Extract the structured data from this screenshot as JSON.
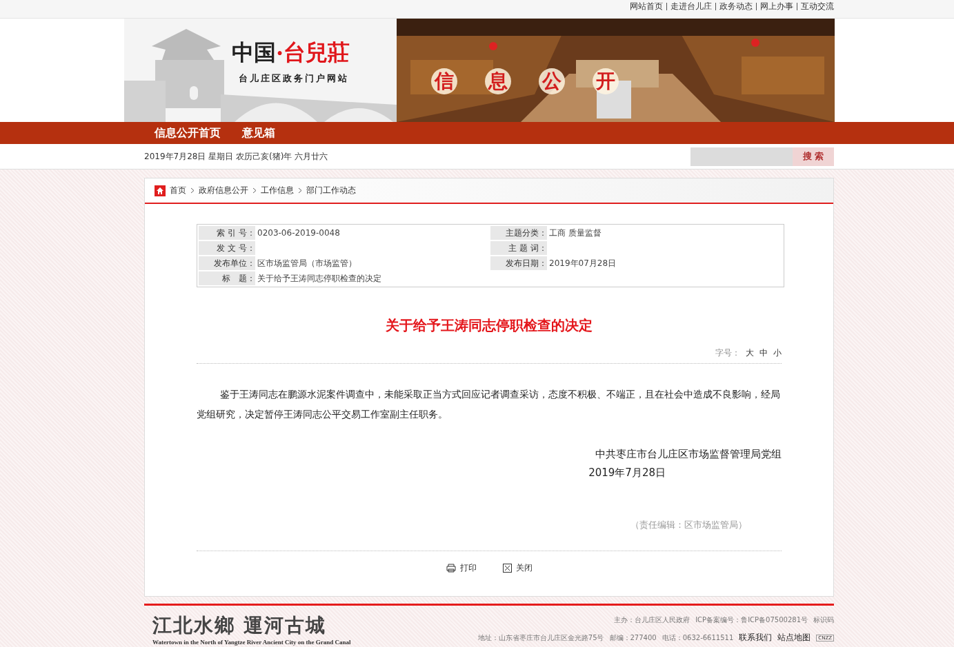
{
  "top_links": [
    "网站首页",
    "走进台儿庄",
    "政务动态",
    "网上办事",
    "互动交流"
  ],
  "header": {
    "logo_main": "中国",
    "logo_dot": "·",
    "logo_accent": "台兒莊",
    "logo_sub": "台儿庄区政务门户网站",
    "banner_title": [
      "信",
      "息",
      "公",
      "开"
    ],
    "photo": {
      "kind": "picture"
    }
  },
  "nav": [
    "信息公开首页",
    "意见箱"
  ],
  "date_line": "2019年7月28日  星期日  农历己亥(猪)年  六月廿六",
  "search": {
    "button": "搜 索"
  },
  "breadcrumb": [
    "首页",
    "政府信息公开",
    "工作信息",
    "部门工作动态"
  ],
  "info_table": [
    [
      {
        "label": "索 引 号：",
        "value": "0203-06-2019-0048"
      },
      {
        "label": "主题分类：",
        "value": "工商 质量监督"
      }
    ],
    [
      {
        "label": "发 文 号："
      },
      {
        "label": "主 题 词："
      }
    ],
    [
      {
        "label": "发布单位：",
        "value": "区市场监管局（市场监管）"
      },
      {
        "label": "发布日期：",
        "value": "2019年07月28日"
      }
    ],
    [
      {
        "label": "标　题：",
        "value": "关于给予王涛同志停职检查的决定"
      }
    ]
  ],
  "article": {
    "title": "关于给予王涛同志停职检查的决定",
    "font_label": "字号：",
    "font_sizes": [
      "大",
      "中",
      "小"
    ],
    "paragraph": "鉴于王涛同志在鹏源水泥案件调查中，未能采取正当方式回应记者调查采访，态度不积极、不端正，且在社会中造成不良影响，经局党组研究，决定暂停王涛同志公平交易工作室副主任职务。",
    "signature": "中共枣庄市台儿庄区市场监督管理局党组",
    "sign_date": "2019年7月28日",
    "editor": "（责任编辑：区市场监管局）"
  },
  "actions": [
    "打印",
    "关闭"
  ],
  "footer": {
    "slogan": "江北水鄉  運河古城",
    "slogan_en": "Watertown in the North of Yangtze River Ancient City on the Grand Canal",
    "line1": [
      "主办：台儿庄区人民政府",
      "ICP备案编号：鲁ICP备07500281号",
      "标识码"
    ],
    "line2": [
      "地址：山东省枣庄市台儿庄区金光路75号",
      "邮编：277400",
      "电话：0632-6611511"
    ],
    "links": [
      "联系我们",
      "站点地图"
    ],
    "badge": "CNZZ"
  }
}
